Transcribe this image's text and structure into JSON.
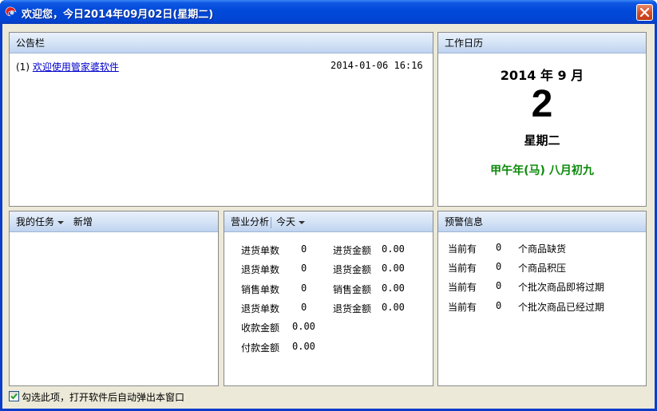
{
  "window": {
    "title": "欢迎您，今日2014年09月02日(星期二)"
  },
  "bulletin": {
    "header": "公告栏",
    "items": [
      {
        "index": "(1)",
        "text": "欢迎使用管家婆软件",
        "date": "2014-01-06 16:16"
      }
    ]
  },
  "calendar": {
    "header": "工作日历",
    "year_month": "2014 年 9 月",
    "day": "2",
    "weekday": "星期二",
    "lunar": "甲午年(马) 八月初九",
    "lunar_color": "#0a8a0a"
  },
  "tasks": {
    "header_label": "我的任务",
    "add_label": "新增"
  },
  "business": {
    "header_label": "营业分析",
    "period": "今天",
    "left_rows": [
      {
        "label": "进货单数",
        "value": "0"
      },
      {
        "label": "退货单数",
        "value": "0"
      },
      {
        "label": "销售单数",
        "value": "0"
      },
      {
        "label": "退货单数",
        "value": "0"
      }
    ],
    "right_rows": [
      {
        "label": "进货金额",
        "value": "0.00"
      },
      {
        "label": "退货金额",
        "value": "0.00"
      },
      {
        "label": "销售金额",
        "value": "0.00"
      },
      {
        "label": "退货金额",
        "value": "0.00"
      }
    ],
    "bottom_rows": [
      {
        "label": "收款金额",
        "value": "0.00"
      },
      {
        "label": "付款金额",
        "value": "0.00"
      }
    ]
  },
  "warning": {
    "header": "预警信息",
    "rows": [
      {
        "prefix": "当前有",
        "count": "0",
        "text": "个商品缺货"
      },
      {
        "prefix": "当前有",
        "count": "0",
        "text": "个商品积压"
      },
      {
        "prefix": "当前有",
        "count": "0",
        "text": "个批次商品即将过期"
      },
      {
        "prefix": "当前有",
        "count": "0",
        "text": "个批次商品已经过期"
      }
    ]
  },
  "footer": {
    "checkbox_label": "勾选此项，打开软件后自动弹出本窗口",
    "checked": true
  }
}
